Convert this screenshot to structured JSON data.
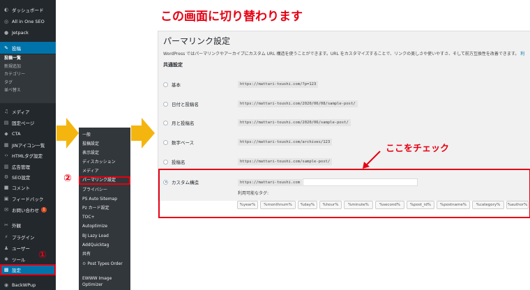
{
  "heading": "この画面に切り替わります",
  "sidebar": {
    "items": [
      {
        "icon": "dashboard-icon",
        "label": "ダッシュボード"
      },
      {
        "icon": "seo-icon",
        "label": "All in One SEO"
      },
      {
        "icon": "jetpack-icon",
        "label": "Jetpack"
      },
      {
        "icon": "pin-icon",
        "label": "投稿"
      },
      {
        "icon": "media-icon",
        "label": "メディア"
      },
      {
        "icon": "page-icon",
        "label": "固定ページ"
      },
      {
        "icon": "cta-icon",
        "label": "CTA"
      },
      {
        "icon": "jin-icon",
        "label": "JINアイコン一覧"
      },
      {
        "icon": "code-icon",
        "label": "HTMLタグ設定"
      },
      {
        "icon": "ad-icon",
        "label": "広告管理"
      },
      {
        "icon": "seo-settings-icon",
        "label": "SEO設定"
      },
      {
        "icon": "comment-icon",
        "label": "コメント"
      },
      {
        "icon": "feedback-icon",
        "label": "フィードバック"
      },
      {
        "icon": "mail-icon",
        "label": "お問い合わせ",
        "badge": "1"
      },
      {
        "icon": "appearance-icon",
        "label": "外観"
      },
      {
        "icon": "plugin-icon",
        "label": "プラグイン"
      },
      {
        "icon": "user-icon",
        "label": "ユーザー"
      },
      {
        "icon": "tool-icon",
        "label": "ツール"
      },
      {
        "icon": "settings-icon",
        "label": "設定"
      },
      {
        "icon": "backup-icon",
        "label": "BackWPup"
      }
    ],
    "post_submenu": [
      "投稿一覧",
      "新規追加",
      "カテゴリー",
      "タグ",
      "並べ替え"
    ]
  },
  "flyout": {
    "items": [
      "一般",
      "投稿設定",
      "表示設定",
      "ディスカッション",
      "メディア",
      "パーマリンク設定",
      "プライバシー",
      "PS Auto Sitemap",
      "Pz カード設定",
      "TOC+",
      "Autoptimize",
      "BJ Lazy Load",
      "AddQuicktag",
      "共有",
      "Post Types Order",
      "EWWW Image",
      "Optimizer"
    ],
    "selected_index": 5
  },
  "markers": {
    "one": "①",
    "two": "②"
  },
  "permalink": {
    "title": "パーマリンク設定",
    "description": "WordPress ではパーマリンクやアーカイブにカスタム URL 構造を使うことができます。URL をカスタマイズすることで、リンクの美しさや使いやすさ、そして前方互換性を改善できます。",
    "description_link": "利",
    "section_title": "共通設定",
    "options": [
      {
        "label": "基本",
        "url": "https://mattari-toushi.com/?p=123"
      },
      {
        "label": "日付と投稿名",
        "url": "https://mattari-toushi.com/2020/06/08/sample-post/"
      },
      {
        "label": "月と投稿名",
        "url": "https://mattari-toushi.com/2020/06/sample-post/"
      },
      {
        "label": "数字ベース",
        "url": "https://mattari-toushi.com/archives/123"
      },
      {
        "label": "投稿名",
        "url": "https://mattari-toushi.com/sample-post/"
      },
      {
        "label": "カスタム構造",
        "url": "https://mattari-toushi.com"
      }
    ],
    "custom_value": "",
    "tags_label": "利用可能なタグ:",
    "tags": [
      "%year%",
      "%monthnum%",
      "%day%",
      "%hour%",
      "%minute%",
      "%second%",
      "%post_id%",
      "%postname%",
      "%category%",
      "%author%"
    ]
  },
  "callout": "ここをチェック"
}
